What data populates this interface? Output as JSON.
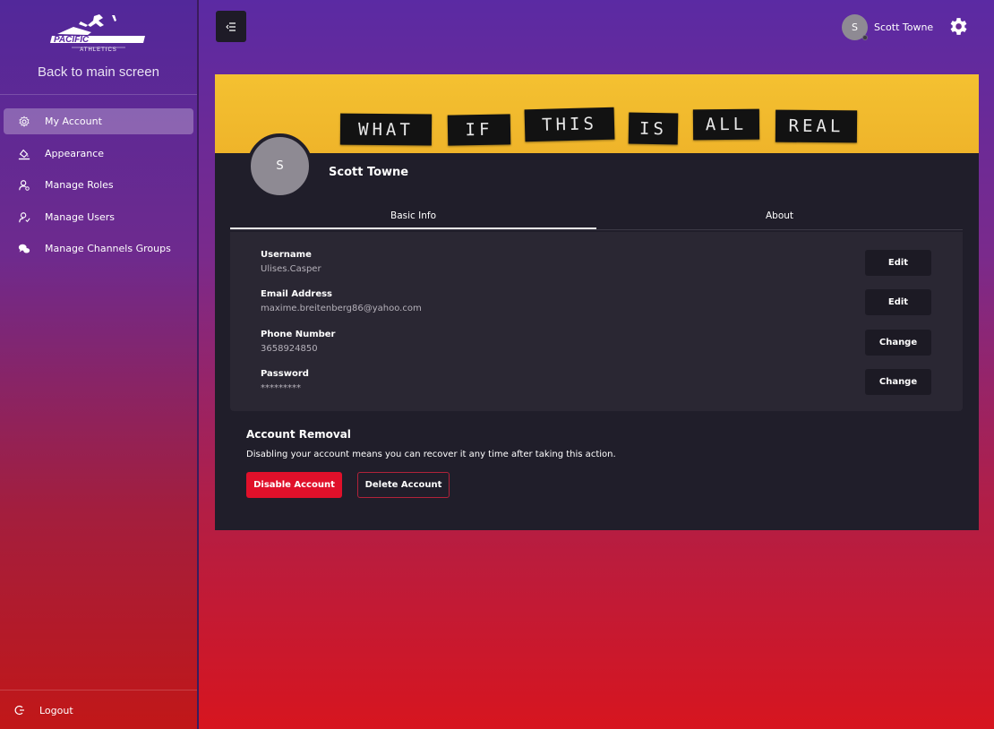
{
  "brand": {
    "logo_text": "PACIFIC",
    "logo_subtext": "ATHLETICS"
  },
  "sidebar": {
    "back_label": "Back to main screen",
    "items": [
      {
        "label": "My Account",
        "icon": "gear-icon",
        "active": true
      },
      {
        "label": "Appearance",
        "icon": "paint-bucket-icon",
        "active": false
      },
      {
        "label": "Manage Roles",
        "icon": "user-roles-icon",
        "active": false
      },
      {
        "label": "Manage Users",
        "icon": "users-icon",
        "active": false
      },
      {
        "label": "Manage Channels Groups",
        "icon": "chat-bubbles-icon",
        "active": false
      }
    ],
    "logout_label": "Logout"
  },
  "header": {
    "avatar_initial": "S",
    "user_name": "Scott Towne"
  },
  "profile": {
    "banner_words": [
      "WHAT",
      "IF",
      "THIS",
      "IS",
      "ALL",
      "REAL"
    ],
    "avatar_initial": "S",
    "name": "Scott Towne"
  },
  "tabs": [
    {
      "label": "Basic Info",
      "active": true
    },
    {
      "label": "About",
      "active": false
    }
  ],
  "basic_info": {
    "fields": [
      {
        "label": "Username",
        "value": "Ulises.Casper",
        "action": "Edit"
      },
      {
        "label": "Email Address",
        "value": "maxime.breitenberg86@yahoo.com",
        "action": "Edit"
      },
      {
        "label": "Phone Number",
        "value": "3658924850",
        "action": "Change"
      },
      {
        "label": "Password",
        "value": "*********",
        "action": "Change"
      }
    ]
  },
  "account_removal": {
    "title": "Account Removal",
    "description": "Disabling your account means you can recover it any time after taking this action.",
    "disable_label": "Disable Account",
    "delete_label": "Delete Account"
  },
  "colors": {
    "accent_red": "#e0102a",
    "card_bg": "#201e2a",
    "banner_yellow": "#f4c131"
  }
}
